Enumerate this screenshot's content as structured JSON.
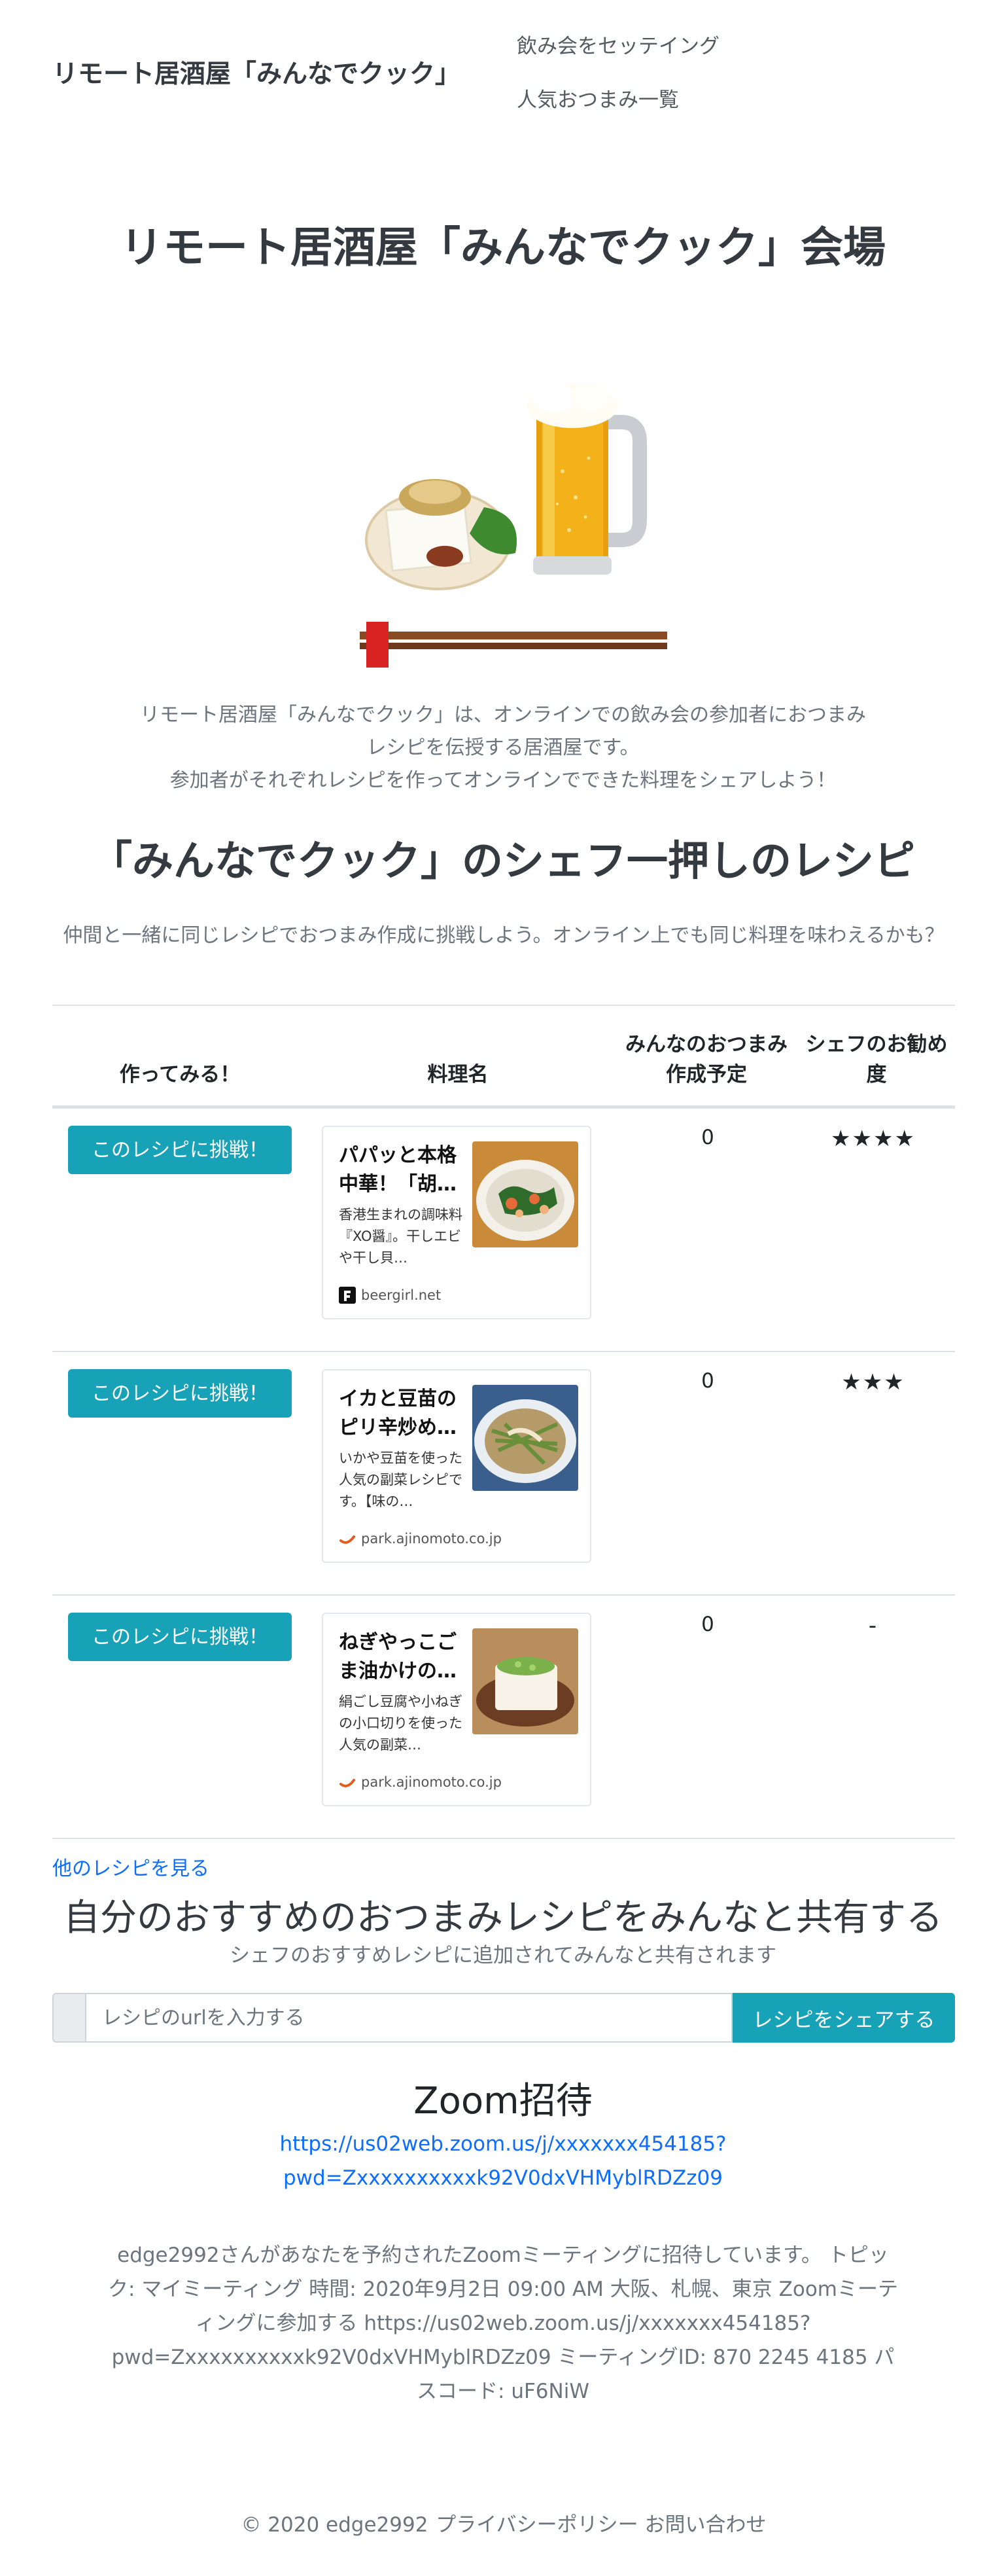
{
  "navbar": {
    "brand": "リモート居酒屋「みんなでクック」",
    "links": [
      "飲み会をセッテイング",
      "人気おつまみ一覧"
    ]
  },
  "hero": {
    "title": "リモート居酒屋「みんなでクック」会場",
    "image_icon": "beer-and-appetizer-illustration",
    "desc_line1": "リモート居酒屋「みんなでクック」は、オンラインでの飲み会の参加者におつまみ",
    "desc_line2": "レシピを伝授する居酒屋です。",
    "desc_line3": "参加者がそれぞれレシピを作ってオンラインでできた料理をシェアしよう！"
  },
  "recipes_section": {
    "title": "「みんなでクック」のシェフ一押しのレシピ",
    "lead": "仲間と一緒に同じレシピでおつまみ作成に挑戦しよう。オンライン上でも同じ料理を味わえるかも？",
    "headers": {
      "try": "作ってみる！",
      "name": "料理名",
      "plan": "みんなのおつまみ作成予定",
      "rating": "シェフのお勧め度"
    },
    "rows": [
      {
        "button": "このレシピに挑戦！",
        "card_title": "パパッと本格中華！「胡…",
        "card_desc": "香港生まれの調味料『XO醤』。干しエビや干し貝…",
        "site": "beergirl.net",
        "site_icon": "beergirl-logo-icon",
        "count": "0",
        "stars": "★★★★"
      },
      {
        "button": "このレシピに挑戦！",
        "card_title": "イカと豆苗のピリ辛炒め…",
        "card_desc": "いかや豆苗を使った人気の副菜レシピです。【味の…",
        "site": "park.ajinomoto.co.jp",
        "site_icon": "ajinomoto-logo-icon",
        "count": "0",
        "stars": "★★★"
      },
      {
        "button": "このレシピに挑戦！",
        "card_title": "ねぎやっこごま油かけの…",
        "card_desc": "絹ごし豆腐や小ねぎの小口切りを使った人気の副菜…",
        "site": "park.ajinomoto.co.jp",
        "site_icon": "ajinomoto-logo-icon",
        "count": "0",
        "stars": "-"
      }
    ],
    "more_link": "他のレシピを見る"
  },
  "share": {
    "title": "自分のおすすめのおつまみレシピをみんなと共有する",
    "lead": "シェフのおすすめレシピに追加されてみんなと共有されます",
    "placeholder": "レシピのurlを入力する",
    "value": "",
    "button": "レシピをシェアする"
  },
  "zoom": {
    "title": "Zoom招待",
    "link_line1": "https://us02web.zoom.us/j/xxxxxxx454185?",
    "link_line2": "pwd=Zxxxxxxxxxxk92V0dxVHMyblRDZz09",
    "text": "edge2992さんがあなたを予約されたZoomミーティングに招待しています。 トピック: マイミーティング 時間: 2020年9月2日 09:00 AM 大阪、札幌、東京 Zoomミーティングに参加する https://us02web.zoom.us/j/xxxxxxx454185?pwd=Zxxxxxxxxxxk92V0dxVHMyblRDZz09 ミーティングID: 870 2245 4185 パスコード: uF6NiW"
  },
  "footer": {
    "copyright": "© 2020 edge2992",
    "privacy": "プライバシーポリシー",
    "contact": "お問い合わせ"
  },
  "colors": {
    "accent": "#17a2b8",
    "link": "#0d6efd",
    "muted": "#6c757d",
    "heading": "#343a40"
  }
}
